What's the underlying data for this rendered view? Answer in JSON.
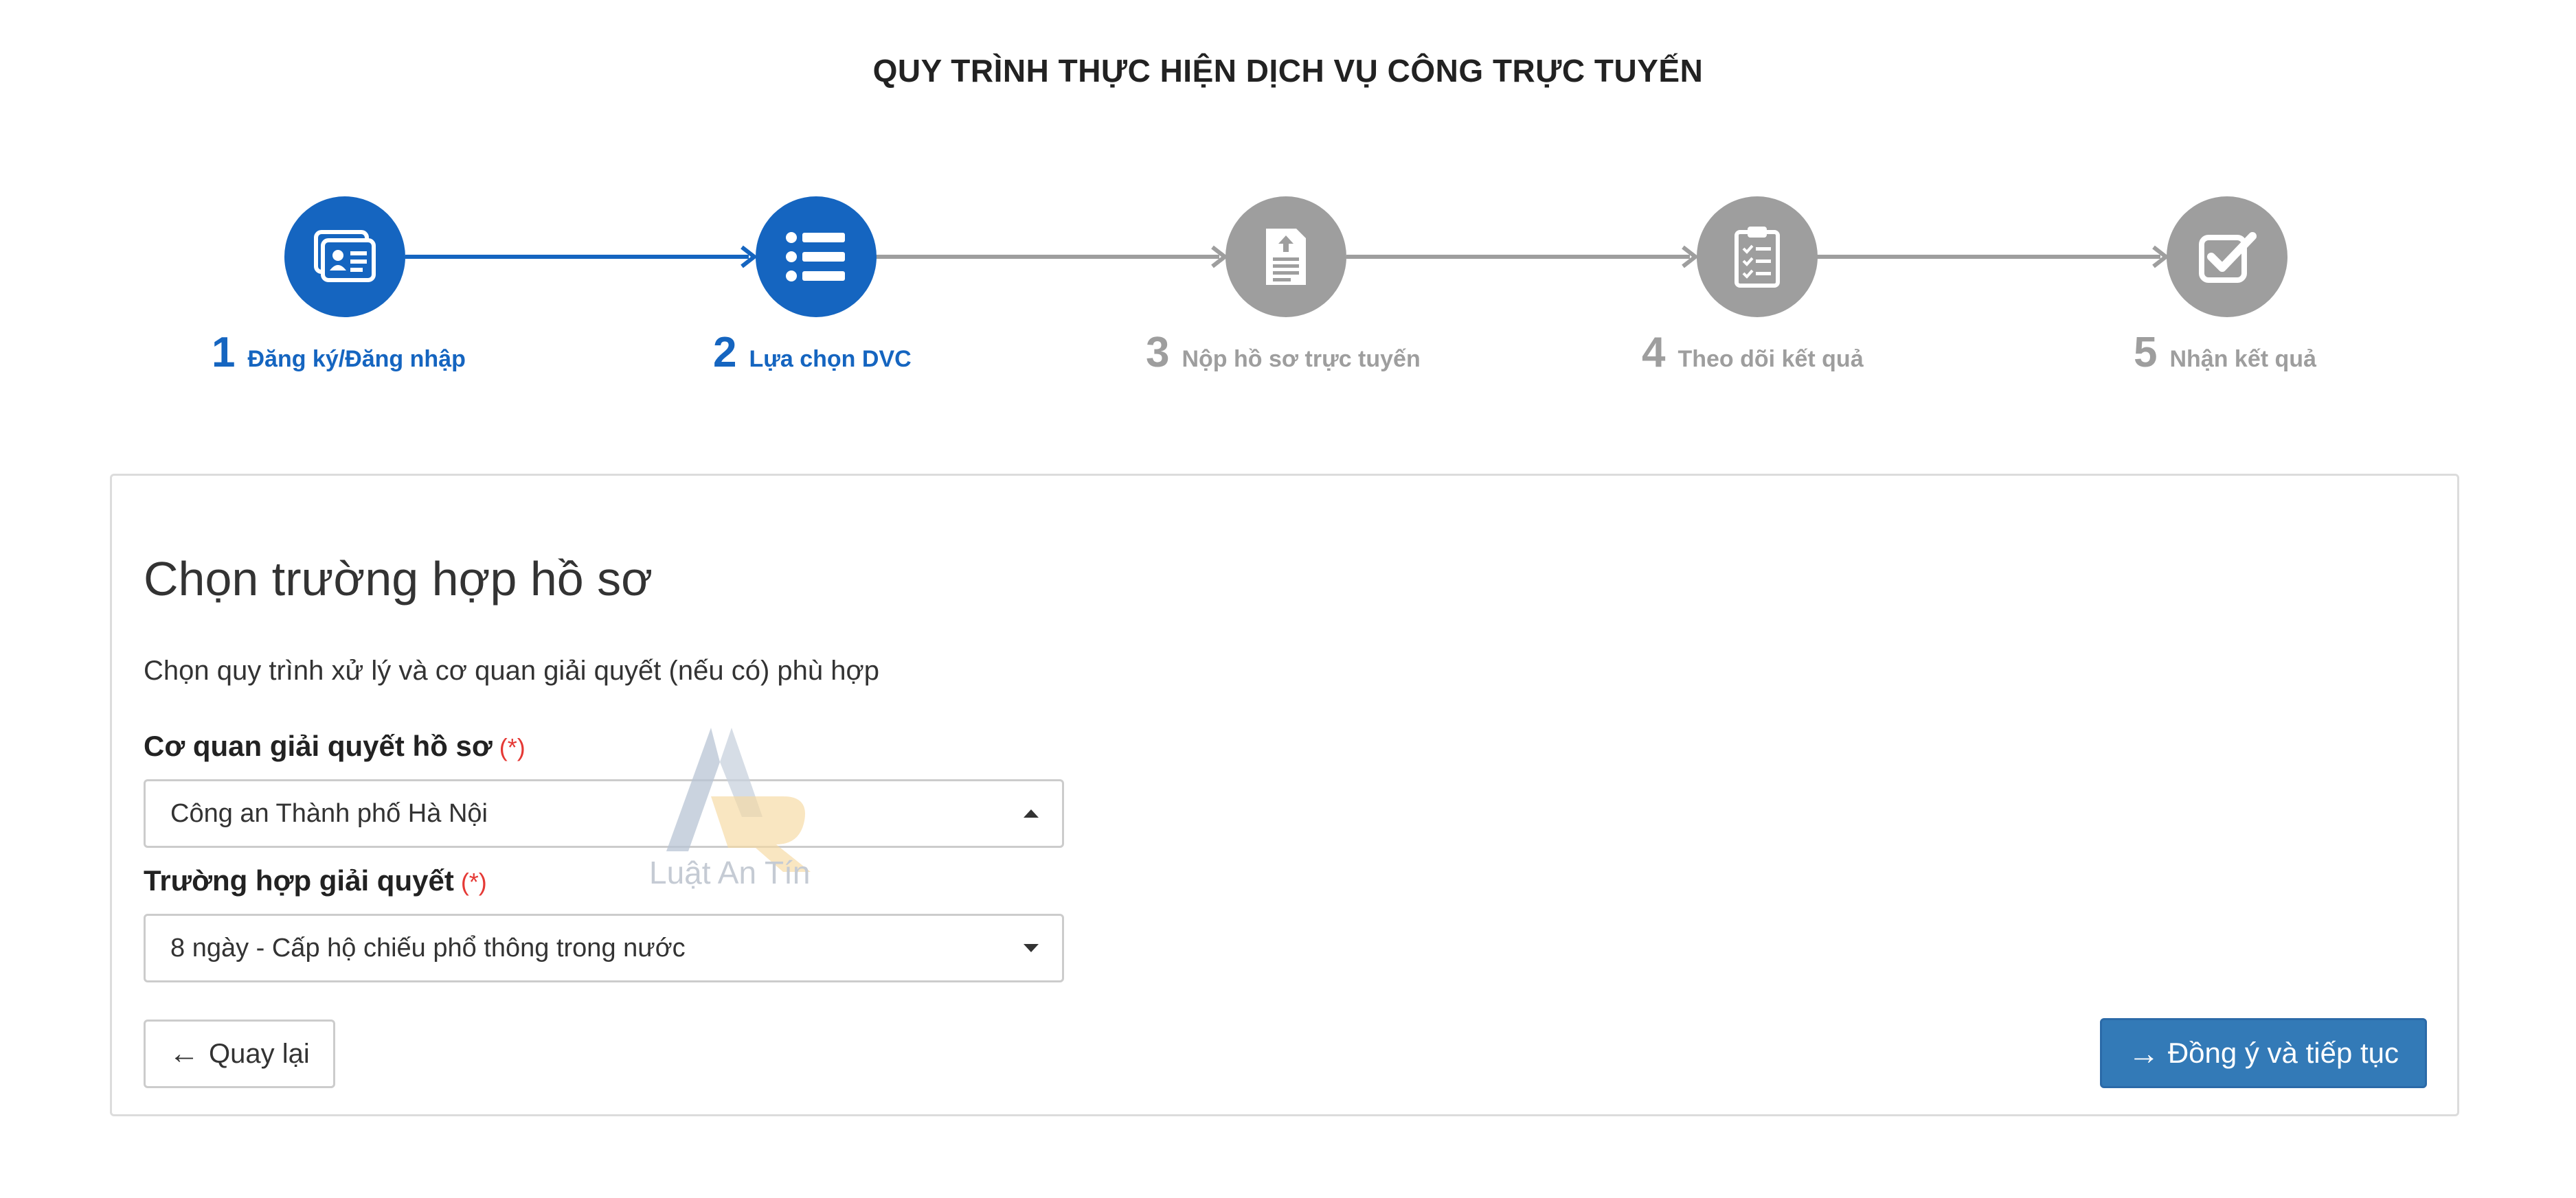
{
  "page": {
    "title": "QUY TRÌNH THỰC HIỆN DỊCH VỤ CÔNG TRỰC TUYẾN"
  },
  "steps": [
    {
      "number": "1",
      "label": "Đăng ký/Đăng nhập",
      "state": "completed",
      "icon": "id-card-icon"
    },
    {
      "number": "2",
      "label": "Lựa chọn DVC",
      "state": "current",
      "icon": "list-icon"
    },
    {
      "number": "3",
      "label": "Nộp hồ sơ trực tuyến",
      "state": "pending",
      "icon": "upload-document-icon"
    },
    {
      "number": "4",
      "label": "Theo dõi kết quả",
      "state": "pending",
      "icon": "clipboard-checklist-icon"
    },
    {
      "number": "5",
      "label": "Nhận kết quả",
      "state": "pending",
      "icon": "checkbox-icon"
    }
  ],
  "panel": {
    "heading": "Chọn trường hợp hồ sơ",
    "description": "Chọn quy trình xử lý và cơ quan giải quyết (nếu có) phù hợp",
    "agency_field": {
      "label": "Cơ quan giải quyết hồ sơ",
      "required_mark": "(*)",
      "value": "Công an Thành phố Hà Nội"
    },
    "case_field": {
      "label": "Trường hợp giải quyết",
      "required_mark": "(*)",
      "value": "8 ngày - Cấp hộ chiếu phổ thông trong nước"
    },
    "back_button": {
      "label": "Quay lại",
      "icon": "arrow-left-icon"
    },
    "next_button": {
      "label": "Đồng ý và tiếp tục",
      "icon": "arrow-right-icon"
    }
  },
  "watermark": {
    "text": "Luật An Tín"
  },
  "colors": {
    "active": "#1565c0",
    "inactive": "#9e9e9e",
    "primary_button": "#337ab7",
    "required": "#e53935"
  }
}
